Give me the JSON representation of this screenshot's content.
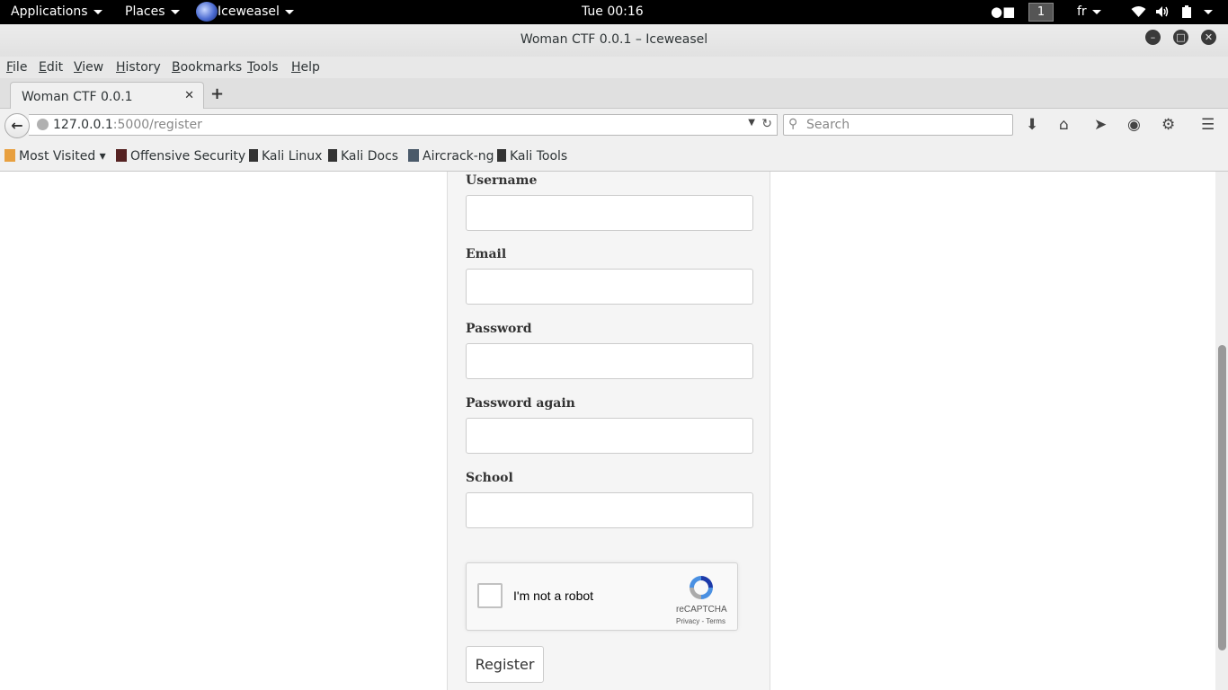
{
  "topbar": {
    "applications": "Applications",
    "places": "Places",
    "app_name": "Iceweasel",
    "clock": "Tue 00:16",
    "workspace": "1",
    "keyboard_layout": "fr"
  },
  "window": {
    "title": "Woman CTF 0.0.1 – Iceweasel"
  },
  "menu": [
    "File",
    "Edit",
    "View",
    "History",
    "Bookmarks",
    "Tools",
    "Help"
  ],
  "tab": {
    "label": "Woman CTF 0.0.1"
  },
  "urlbar": {
    "host": "127.0.0.1",
    "path": ":5000/register"
  },
  "search": {
    "placeholder": "Search"
  },
  "bookmarks": [
    "Most Visited",
    "Offensive Security",
    "Kali Linux",
    "Kali Docs",
    "Aircrack-ng",
    "Kali Tools"
  ],
  "form": {
    "username_label": "Username",
    "email_label": "Email",
    "password_label": "Password",
    "password_again_label": "Password again",
    "school_label": "School",
    "username_value": "",
    "email_value": "",
    "password_value": "",
    "password_again_value": "",
    "school_value": "",
    "captcha_text": "I'm not a robot",
    "captcha_brand": "reCAPTCHA",
    "captcha_terms": "Privacy - Terms",
    "register_label": "Register"
  }
}
